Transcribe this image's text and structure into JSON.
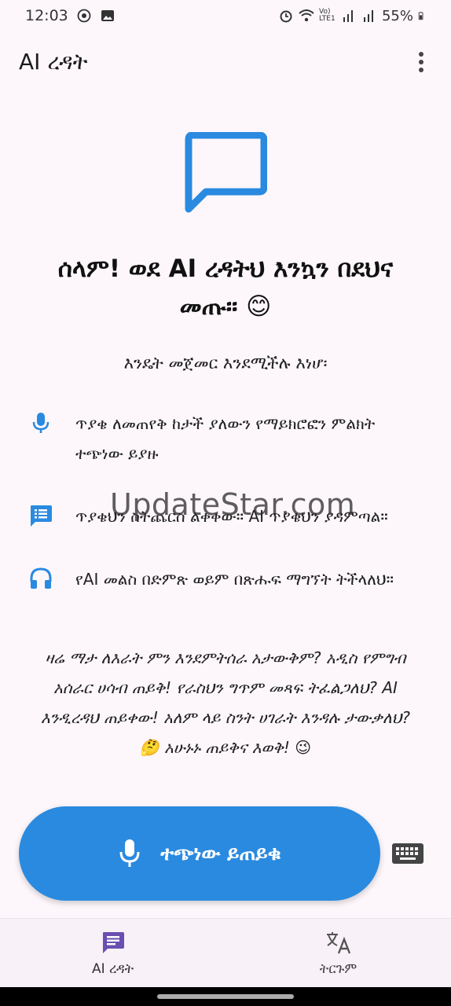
{
  "status_bar": {
    "time": "12:03",
    "battery": "55%",
    "network": "Vo) LTE1"
  },
  "app_bar": {
    "title": "AI ረዳት"
  },
  "welcome": {
    "title": "ሰላም! ወደ AI ረዳትህ እንኳን በደህና መጡ። 😊"
  },
  "subtitle": "እንዴት መጀመር እንደሚችሉ እነሆ፡",
  "tips": [
    {
      "icon": "mic-icon",
      "text": "ጥያቄ ለመጠየቅ ከታች ያለውን የማይክሮፎን ምልክት ተጭነው ይያዙ"
    },
    {
      "icon": "list-chat-icon",
      "text": "ጥያቄህን ስትጨርስ ልቀቀው። AI ጥያቄህን ያዳምጣል።"
    },
    {
      "icon": "headphones-icon",
      "text": "የAI መልስ በድምጽ ወይም በጽሑፍ ማግኘት ትችላለህ።"
    }
  ],
  "watermark": "UpdateStar.com",
  "promo": "ዛሬ ማታ ለእራት ምን እንደምትሰራ አታውቅም? አዲስ የምግብ አሰራር ሀሳብ ጠይቅ! የራስህን ግጥም መጻፍ ትፈልጋለህ? AI እንዲረዳህ ጠይቀው! አለም ላይ ስንት ሀገራት እንዳሉ ታውቃለህ? 🤔 አሁኑኑ ጠይቅና እወቅ! 😉",
  "ask_button": {
    "label": "ተጭነው ይጠይቁ"
  },
  "bottom_nav": [
    {
      "label": "AI ረዳት",
      "icon": "chat-icon",
      "active": true
    },
    {
      "label": "ትርጉም",
      "icon": "translate-icon",
      "active": false
    }
  ],
  "colors": {
    "accent": "#2a8ae0",
    "background": "#fdf7fb",
    "nav_active_icon": "#6a4fb0"
  }
}
